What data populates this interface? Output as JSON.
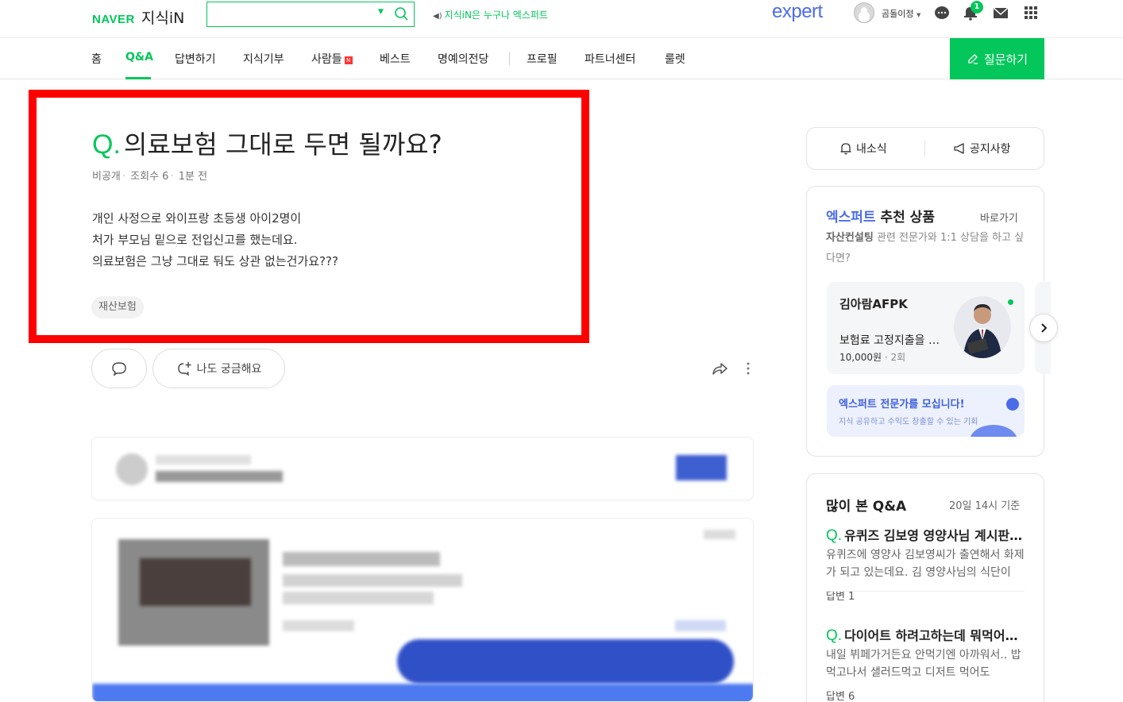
{
  "header": {
    "logo_naver": "NAVER",
    "logo_kin": "지식iN",
    "search_placeholder": "",
    "notice": "지식iN은 누구나 엑스퍼트",
    "expert_logo": "expert",
    "username": "곰돌이정",
    "alarm_count": "1"
  },
  "nav": {
    "items": [
      "홈",
      "Q&A",
      "답변하기",
      "지식기부",
      "사람들",
      "베스트",
      "명예의전당",
      "프로필",
      "파트너센터",
      "룰렛"
    ],
    "new_badge": "N",
    "ask_button": "질문하기"
  },
  "question": {
    "q_mark": "Q.",
    "title": "의료보험 그대로 두면 될까요?",
    "author": "비공개",
    "views": "조회수 6",
    "time": "1분 전",
    "body": [
      "개인 사정으로 와이프랑 초등생 아이2명이",
      "처가 부모님 밑으로 전입신고를 했는데요.",
      "의료보험은 그냥 그대로 둬도 상관 없는건가요???"
    ],
    "tag": "재산보험",
    "curious_button": "나도 궁금해요"
  },
  "sidebar": {
    "tab_news": "내소식",
    "tab_notice": "공지사항",
    "expert_title_blue": "엑스퍼트",
    "expert_title_rest": "추천 상품",
    "expert_link": "바로가기",
    "expert_sub_bold": "자산컨설팅",
    "expert_sub_rest": "관련 전문가와 1:1 상담을 하고 싶다면?",
    "expert_name": "김아람AFPK",
    "expert_product": "보험료 고정지출을 줄이는 방법",
    "expert_price": "10,000원",
    "expert_count": "2회",
    "recruit_title": "엑스퍼트 전문가를 모십니다!",
    "recruit_sub": "지식 공유하고 수익도 창출할 수 있는 기회",
    "popular_title": "많이 본 Q&A",
    "popular_time": "20일 14시 기준",
    "popular": [
      {
        "q": "Q.",
        "title": "유퀴즈 김보영 영양사님 계시판 식단",
        "body": "유퀴즈에 영양사 김보영씨가 출연해서 화제가 되고 있는데요. 김 영양사님의 식단이",
        "answers": "답변 1"
      },
      {
        "q": "Q.",
        "title": "다이어트 하려고하는데 뭐먹어야 할까요",
        "body": "내일 뷔페가거든요 안먹기엔 아까워서.. 밥 먹고나서 샐러드먹고 디저트 먹어도",
        "answers": "답변 6"
      }
    ]
  }
}
